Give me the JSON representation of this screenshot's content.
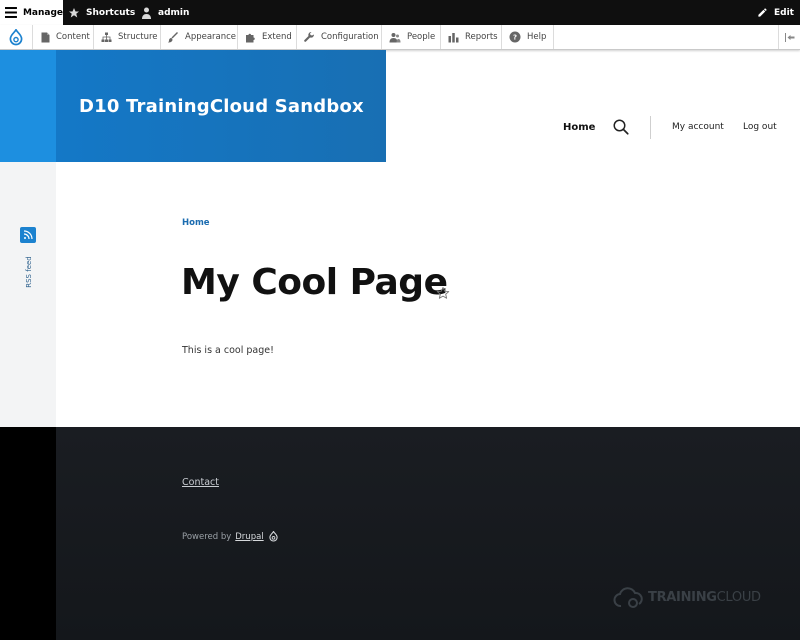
{
  "admin_bar": {
    "manage_label": "Manage",
    "shortcuts_label": "Shortcuts",
    "user_label": "admin",
    "edit_label": "Edit"
  },
  "admin_tray": {
    "items": [
      {
        "label": "Content",
        "icon": "file-icon"
      },
      {
        "label": "Structure",
        "icon": "sitemap-icon"
      },
      {
        "label": "Appearance",
        "icon": "paintbrush-icon"
      },
      {
        "label": "Extend",
        "icon": "puzzle-icon"
      },
      {
        "label": "Configuration",
        "icon": "wrench-icon"
      },
      {
        "label": "People",
        "icon": "people-icon"
      },
      {
        "label": "Reports",
        "icon": "bar-chart-icon"
      },
      {
        "label": "Help",
        "icon": "help-icon"
      }
    ]
  },
  "header": {
    "site_name": "D10 TrainingCloud Sandbox",
    "nav_home": "Home",
    "nav_account": "My account",
    "nav_logout": "Log out"
  },
  "social": {
    "rss_label": "RSS feed"
  },
  "main": {
    "breadcrumb": "Home",
    "title": "My Cool Page",
    "body": "This is a cool page!"
  },
  "footer": {
    "contact": "Contact",
    "powered_prefix": "Powered by",
    "powered_link": "Drupal",
    "logo_text_bold": "TRAINING",
    "logo_text_light": "CLOUD"
  },
  "colors": {
    "brand_blue": "#1478c7",
    "footer_bg": "#1a1d22",
    "admin_bar_bg": "#0f0f0f"
  }
}
